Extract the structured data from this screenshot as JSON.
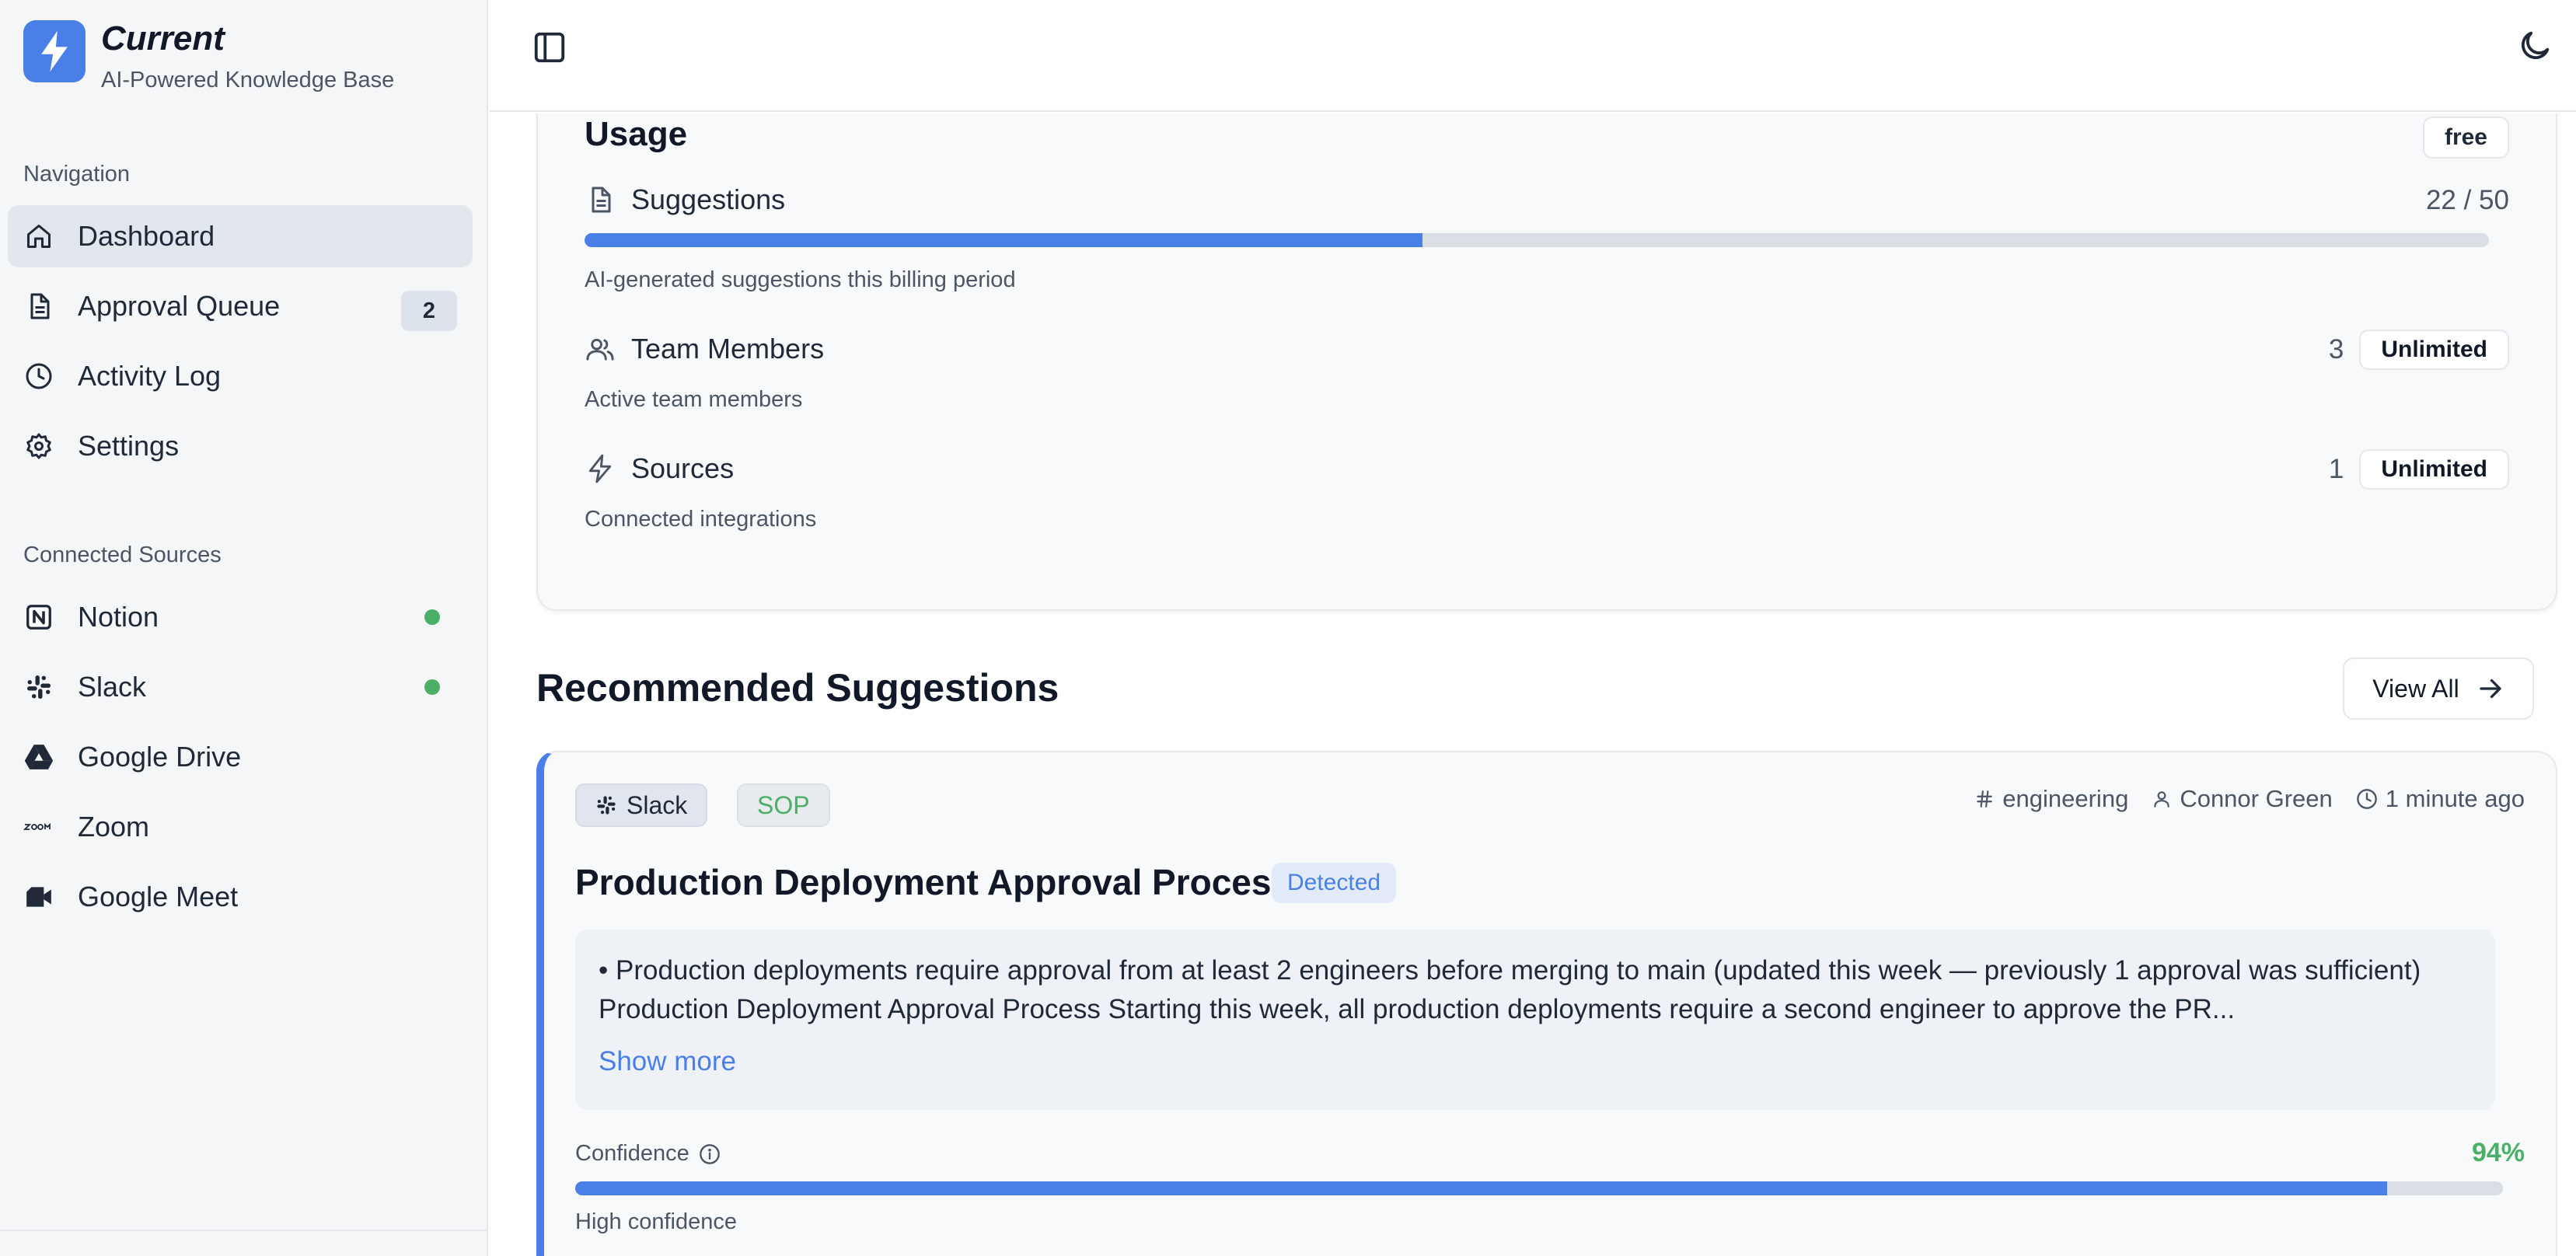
{
  "brand": {
    "name": "Current",
    "tagline": "AI-Powered Knowledge Base",
    "accent": "#4a7fe8"
  },
  "sidebar": {
    "nav_heading": "Navigation",
    "nav_items": [
      {
        "label": "Dashboard",
        "icon": "home-icon",
        "active": true
      },
      {
        "label": "Approval Queue",
        "icon": "document-icon",
        "badge": "2"
      },
      {
        "label": "Activity Log",
        "icon": "clock-icon"
      },
      {
        "label": "Settings",
        "icon": "gear-icon"
      }
    ],
    "sources_heading": "Connected Sources",
    "sources": [
      {
        "label": "Notion",
        "icon": "notion-icon",
        "connected": true
      },
      {
        "label": "Slack",
        "icon": "slack-icon",
        "connected": true
      },
      {
        "label": "Google Drive",
        "icon": "google-drive-icon",
        "connected": false
      },
      {
        "label": "Zoom",
        "icon": "zoom-icon",
        "connected": false
      },
      {
        "label": "Google Meet",
        "icon": "google-meet-icon",
        "connected": false
      }
    ],
    "status_color": "#4caf67"
  },
  "usage": {
    "title": "Usage",
    "plan": "free",
    "suggestions": {
      "label": "Suggestions",
      "count": "22 / 50",
      "used": 22,
      "limit": 50,
      "description": "AI-generated suggestions this billing period"
    },
    "team": {
      "label": "Team Members",
      "count": "3",
      "limit": "Unlimited",
      "description": "Active team members"
    },
    "sources": {
      "label": "Sources",
      "count": "1",
      "limit": "Unlimited",
      "description": "Connected integrations"
    }
  },
  "recommended": {
    "title": "Recommended Suggestions",
    "view_all": "View All",
    "items": [
      {
        "source": "Slack",
        "type": "SOP",
        "channel": "engineering",
        "author": "Connor Green",
        "time": "1 minute ago",
        "title": "Production Deployment Approval Process",
        "status": "Detected",
        "excerpt": "• Production deployments require approval from at least 2 engineers before merging to main (updated this week — previously 1 approval was sufficient) Production Deployment Approval Process Starting this week, all production deployments require a second engineer to approve the PR...",
        "show_more": "Show more",
        "confidence_label": "Confidence",
        "confidence_text": "94%",
        "confidence": 0.94,
        "confidence_level": "High confidence"
      }
    ]
  }
}
